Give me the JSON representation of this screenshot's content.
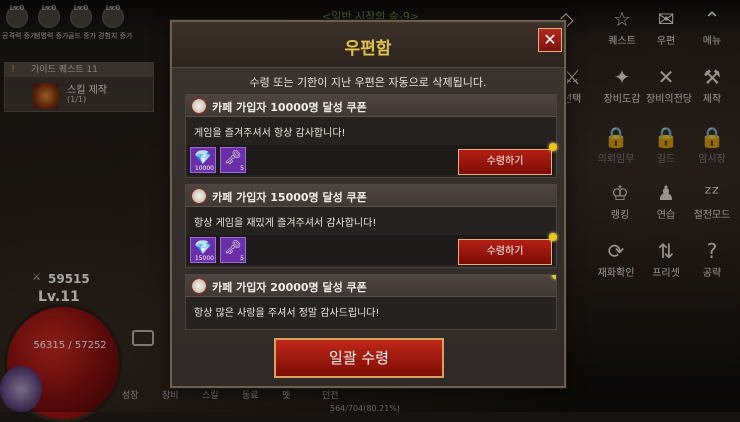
{
  "hud": {
    "stats": [
      {
        "lv": "Lv.0",
        "label": "공격력 증가"
      },
      {
        "lv": "Lv.0",
        "label": "생명력 증가"
      },
      {
        "lv": "Lv.0",
        "label": "골드 증가"
      },
      {
        "lv": "Lv.0",
        "label": "경험치 증가"
      }
    ],
    "stage_title": "<일반 시작의 숲-9>",
    "quest": {
      "header": "가이드 퀘스트 11",
      "title": "스킬 제작",
      "progress": "(1/1)"
    },
    "player": {
      "power": "59515",
      "level": "Lv.11",
      "hp": "56315 / 57252"
    },
    "bottom_items": [
      "성장",
      "장비",
      "스킬",
      "동료",
      "펫",
      "던전"
    ],
    "exp_text": "564/704(80.21%)"
  },
  "right_menu": [
    {
      "icon": "event-icon",
      "glyph": "◇",
      "label": ""
    },
    {
      "icon": "quest-icon",
      "glyph": "☆",
      "label": "퀘스트"
    },
    {
      "icon": "mail-icon",
      "glyph": "✉",
      "label": "우편"
    },
    {
      "icon": "menu-icon",
      "glyph": "⌃",
      "label": "메뉴"
    },
    {
      "icon": "select-icon",
      "glyph": "⚔",
      "label": "선택"
    },
    {
      "icon": "equipment-book-icon",
      "glyph": "✦",
      "label": "장비도감"
    },
    {
      "icon": "equipment-hall-icon",
      "glyph": "✕",
      "label": "장비의전당"
    },
    {
      "icon": "craft-icon",
      "glyph": "⚒",
      "label": "제작"
    },
    {
      "icon": "lock-icon",
      "glyph": "🔒",
      "label": "의뢰임무"
    },
    {
      "icon": "lock-icon",
      "glyph": "🔒",
      "label": "길드"
    },
    {
      "icon": "lock-icon",
      "glyph": "🔒",
      "label": "암시장"
    },
    {
      "icon": "ranking-icon",
      "glyph": "♔",
      "label": "랭킹"
    },
    {
      "icon": "practice-icon",
      "glyph": "♟",
      "label": "연습"
    },
    {
      "icon": "power-save-icon",
      "glyph": "ᶻᶻ",
      "label": "절전모드"
    },
    {
      "icon": "reconnect-icon",
      "glyph": "⟳",
      "label": "재화확인"
    },
    {
      "icon": "preset-icon",
      "glyph": "⇅",
      "label": "프리셋"
    },
    {
      "icon": "help-icon",
      "glyph": "?",
      "label": "공략"
    }
  ],
  "mailbox": {
    "title": "우편함",
    "close_label": "✕",
    "notice": "수령 또는 기한이 지난 우편은 자동으로 삭제됩니다.",
    "mails": [
      {
        "title": "카페 가입자 10000명 달성 쿠폰",
        "body": "게임을 즐겨주셔서 항상 감사합니다!",
        "rewards": [
          {
            "icon": "diamond-icon",
            "glyph": "💎",
            "qty": "10000"
          },
          {
            "icon": "key-icon",
            "glyph": "🗝",
            "qty": "5"
          }
        ],
        "claim_label": "수령하기"
      },
      {
        "title": "카페 가입자 15000명 달성 쿠폰",
        "body": "항상 게임을 재밌게 즐겨주셔서 감사합니다!",
        "rewards": [
          {
            "icon": "diamond-icon",
            "glyph": "💎",
            "qty": "15000"
          },
          {
            "icon": "key-icon",
            "glyph": "🗝",
            "qty": "5"
          }
        ],
        "claim_label": "수령하기"
      },
      {
        "title": "카페 가입자 20000명 달성 쿠폰",
        "body": "항상 많은 사랑을 주셔서 정말 감사드립니다!"
      }
    ],
    "claim_all_label": "일괄 수령"
  }
}
